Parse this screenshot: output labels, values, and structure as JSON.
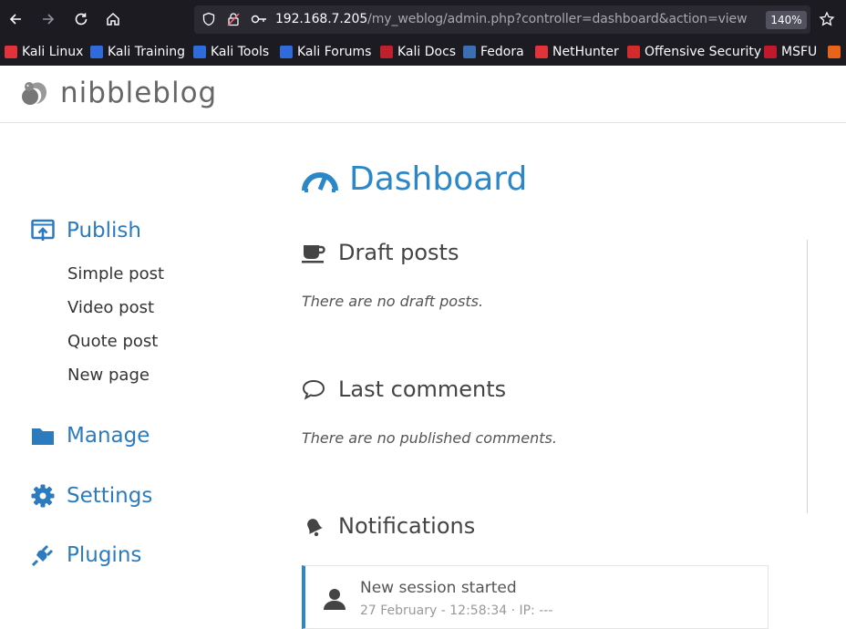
{
  "browser": {
    "url_host": "192.168.7.205",
    "url_path": "/my_weblog/admin.php?controller=dashboard&action=view",
    "zoom": "140%",
    "bookmarks": [
      {
        "label": "Kali Linux",
        "icon": "kali-dragon-icon",
        "color": "#e2333b"
      },
      {
        "label": "Kali Training",
        "icon": "kali-training-icon",
        "color": "#2f6bdb"
      },
      {
        "label": "Kali Tools",
        "icon": "kali-tools-icon",
        "color": "#2f6bdb"
      },
      {
        "label": "Kali Forums",
        "icon": "kali-forums-icon",
        "color": "#2f6bdb"
      },
      {
        "label": "Kali Docs",
        "icon": "kali-docs-icon",
        "color": "#c01f2c"
      },
      {
        "label": "Fedora",
        "icon": "fedora-icon",
        "color": "#3c6eb4"
      },
      {
        "label": "NetHunter",
        "icon": "nethunter-icon",
        "color": "#e2333b"
      },
      {
        "label": "Offensive Security",
        "icon": "offsec-icon",
        "color": "#d12b2b"
      },
      {
        "label": "MSFU",
        "icon": "msfu-icon",
        "color": "#c0192b"
      }
    ]
  },
  "site": {
    "title": "nibbleblog"
  },
  "sidebar": {
    "publish": {
      "label": "Publish",
      "items": [
        "Simple post",
        "Video post",
        "Quote post",
        "New page"
      ]
    },
    "manage": {
      "label": "Manage"
    },
    "settings": {
      "label": "Settings"
    },
    "plugins": {
      "label": "Plugins"
    }
  },
  "main": {
    "title": "Dashboard",
    "draft": {
      "heading": "Draft posts",
      "empty": "There are no draft posts."
    },
    "comments": {
      "heading": "Last comments",
      "empty": "There are no published comments."
    },
    "notifications": {
      "heading": "Notifications",
      "items": [
        {
          "title": "New session started",
          "meta": "27 February - 12:58:34 · IP: ---"
        }
      ]
    }
  },
  "colors": {
    "accent": "#2c87c9",
    "browser_bg": "#1c1b22"
  }
}
